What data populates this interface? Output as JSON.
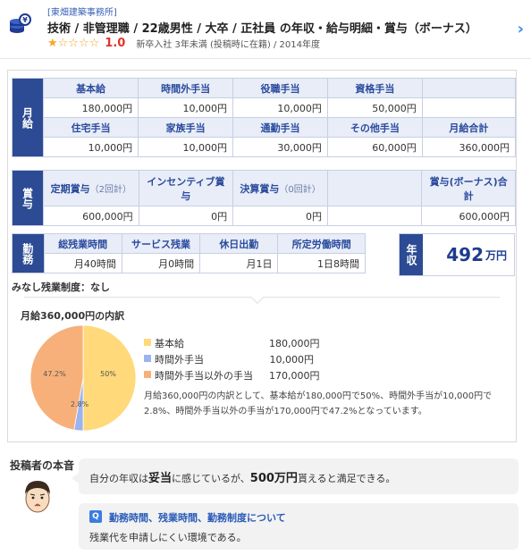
{
  "header": {
    "company": "[東畑建築事務所]",
    "title": "技術 / 非管理職 / 22歳男性 / 大卒 / 正社員 の年収・給与明細・賞与（ボーナス）",
    "stars": "★☆☆☆☆",
    "score": "1.0",
    "meta": "新卒入社 3年未満 (投稿時に在籍) / 2014年度"
  },
  "salary": {
    "label": "月給",
    "row1_heads": [
      "基本給",
      "時間外手当",
      "役職手当",
      "資格手当",
      ""
    ],
    "row1_vals": [
      "180,000円",
      "10,000円",
      "10,000円",
      "50,000円",
      ""
    ],
    "row2_heads": [
      "住宅手当",
      "家族手当",
      "通勤手当",
      "その他手当",
      "月給合計"
    ],
    "row2_vals": [
      "10,000円",
      "10,000円",
      "30,000円",
      "60,000円",
      "360,000円"
    ]
  },
  "bonus": {
    "label": "賞与",
    "heads": [
      "定期賞与",
      "インセンティブ賞与",
      "決算賞与",
      "",
      "賞与(ボーナス)合計"
    ],
    "head_notes": [
      "（2回計）",
      "",
      "（0回計）",
      "",
      ""
    ],
    "vals": [
      "600,000円",
      "0円",
      "0円",
      "",
      "600,000円"
    ]
  },
  "work": {
    "label": "勤務",
    "heads": [
      "総残業時間",
      "サービス残業",
      "休日出勤",
      "所定労働時間"
    ],
    "vals": [
      "月40時間",
      "月0時間",
      "月1日",
      "1日8時間"
    ]
  },
  "annual": {
    "label": "年収",
    "amount": "492",
    "unit": "万円"
  },
  "minashi": "みなし残業制度：なし",
  "breakdown": {
    "title": "月給360,000円の内訳",
    "legend": [
      {
        "label": "基本給",
        "amount": "180,000円",
        "color": "#ffd97a"
      },
      {
        "label": "時間外手当",
        "amount": "10,000円",
        "color": "#9bb3ee"
      },
      {
        "label": "時間外手当以外の手当",
        "amount": "170,000円",
        "color": "#f7b07a"
      }
    ],
    "explain": "月給360,000円の内訳として、基本給が180,000円で50%、時間外手当が10,000円で2.8%、時間外手当以外の手当が170,000円で47.2%となっています。"
  },
  "chart_data": {
    "type": "pie",
    "categories": [
      "基本給",
      "時間外手当",
      "時間外手当以外の手当"
    ],
    "values": [
      180000,
      10000,
      170000
    ],
    "labels": [
      "50%",
      "2.8%",
      "47.2%"
    ],
    "colors": [
      "#ffd97a",
      "#9bb3ee",
      "#f7b07a"
    ]
  },
  "voice": {
    "title": "投稿者の本音",
    "bubble1_pre": "自分の年収は",
    "bubble1_bold1": "妥当",
    "bubble1_mid": "に感じているが、",
    "bubble1_bold2": "500万円",
    "bubble1_post": "貰えると満足できる。",
    "q_badge": "Q",
    "q_title": "勤務時間、残業時間、勤務制度について",
    "q_answer": "残業代を申請しにくい環境である。"
  }
}
